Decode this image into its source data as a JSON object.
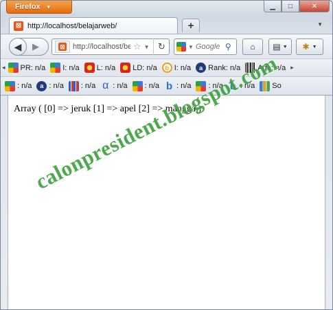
{
  "app": {
    "name": "Firefox"
  },
  "window_controls": {
    "minimize": "▁",
    "maximize": "□",
    "close": "✕"
  },
  "tab": {
    "title": "http://localhost/belajarweb/",
    "new_tab": "+",
    "list": "▼"
  },
  "nav": {
    "back": "◀",
    "forward": "▶",
    "url": "http://localhost/belajarweb/",
    "star": "☆",
    "reload": "↻",
    "search_placeholder": "Google",
    "search_glyph": "🔍",
    "home": "⌂",
    "bookmark_btn": "▤",
    "addon_btn": "✱"
  },
  "toolbar_row1": {
    "scroll_left": "◂",
    "items": [
      {
        "icon": "google-icon",
        "label": "PR: n/a"
      },
      {
        "icon": "google-icon",
        "label": "I: n/a"
      },
      {
        "icon": "sun-icon",
        "label": "L: n/a"
      },
      {
        "icon": "sun-icon",
        "label": "LD: n/a"
      },
      {
        "icon": "bing-icon",
        "label": "I: n/a"
      },
      {
        "icon": "alexa-icon",
        "label": "Rank: n/a"
      },
      {
        "icon": "barcode-icon",
        "label": "Age: n/a"
      }
    ],
    "scroll_right": "▸"
  },
  "toolbar_row2": {
    "items": [
      {
        "icon": "google-icon",
        "label": ": n/a"
      },
      {
        "icon": "alexa-icon",
        "label": ": n/a"
      },
      {
        "icon": "digg-icon",
        "label": ": n/a"
      },
      {
        "icon": "alpha-icon",
        "label": ": n/a"
      },
      {
        "icon": "google-icon",
        "label": ": n/a"
      },
      {
        "icon": "bing-icon",
        "label": ": n/a"
      },
      {
        "icon": "google-icon",
        "label": ": n/a"
      },
      {
        "icon": "bing-icon",
        "label": ": n/a"
      },
      {
        "icon": "chart-icon",
        "label": "So"
      }
    ]
  },
  "content": {
    "text": "Array ( [0] => jeruk [1] => apel [2] => mangga )",
    "watermark": "calonpresident.blogspot.com"
  }
}
